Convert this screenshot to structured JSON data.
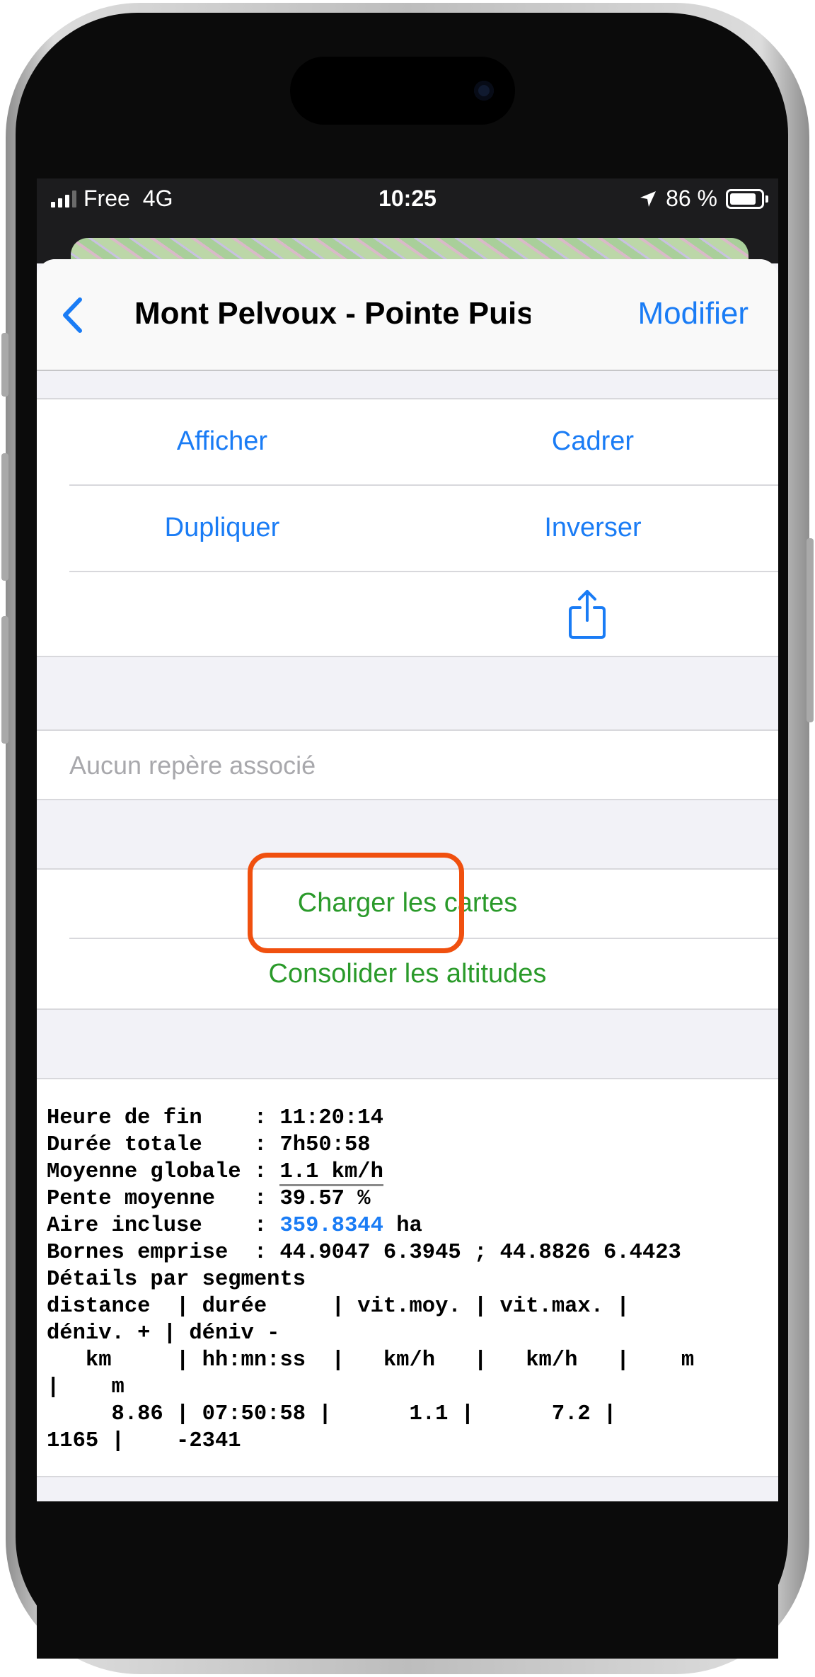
{
  "status_bar": {
    "carrier": "Free",
    "network": "4G",
    "time": "10:25",
    "battery": "86 %",
    "location_icon": "location-arrow-icon",
    "battery_icon": "battery-icon",
    "signal_icon": "signal-bars-icon"
  },
  "nav": {
    "back_icon": "chevron-left-icon",
    "title": "Mont Pelvoux - Pointe Puise...",
    "right_button": "Modifier"
  },
  "actions": {
    "show": "Afficher",
    "frame": "Cadrer",
    "duplicate": "Dupliquer",
    "reverse": "Inverser",
    "share_icon": "share-icon"
  },
  "markers": {
    "placeholder": "Aucun repère associé"
  },
  "tools": {
    "load_maps": "Charger les cartes",
    "consolidate": "Consolider les altitudes"
  },
  "stats": {
    "end_time_label": "Heure de fin    : ",
    "end_time": "11:20:14",
    "duration_label": "Durée totale    : ",
    "duration": "7h50:58",
    "avg_speed_label": "Moyenne globale : ",
    "avg_speed": "1.1 km/h",
    "avg_slope_label": "Pente moyenne   : ",
    "avg_slope": "39.57 %",
    "area_label": "Aire incluse    : ",
    "area_value": "359.8344",
    "area_unit": " ha",
    "bounds_label": "Bornes emprise  : ",
    "bounds": "44.9047 6.3945 ; 44.8826 6.4423",
    "segments_title": "Détails par segments",
    "header_line1": "distance  | durée     | vit.moy. | vit.max. |",
    "header_line2": "déniv. + | déniv -",
    "units_line1": "   km     | hh:mn:ss  |   km/h   |   km/h   |    m",
    "units_line2": "|    m",
    "values_line1": "     8.86 | 07:50:58 |      1.1 |      7.2 |",
    "values_line2": "1165 |    -2341"
  },
  "colors": {
    "accent": "#1a7cf5",
    "green": "#2a9a2a",
    "highlight": "#f0500f"
  }
}
